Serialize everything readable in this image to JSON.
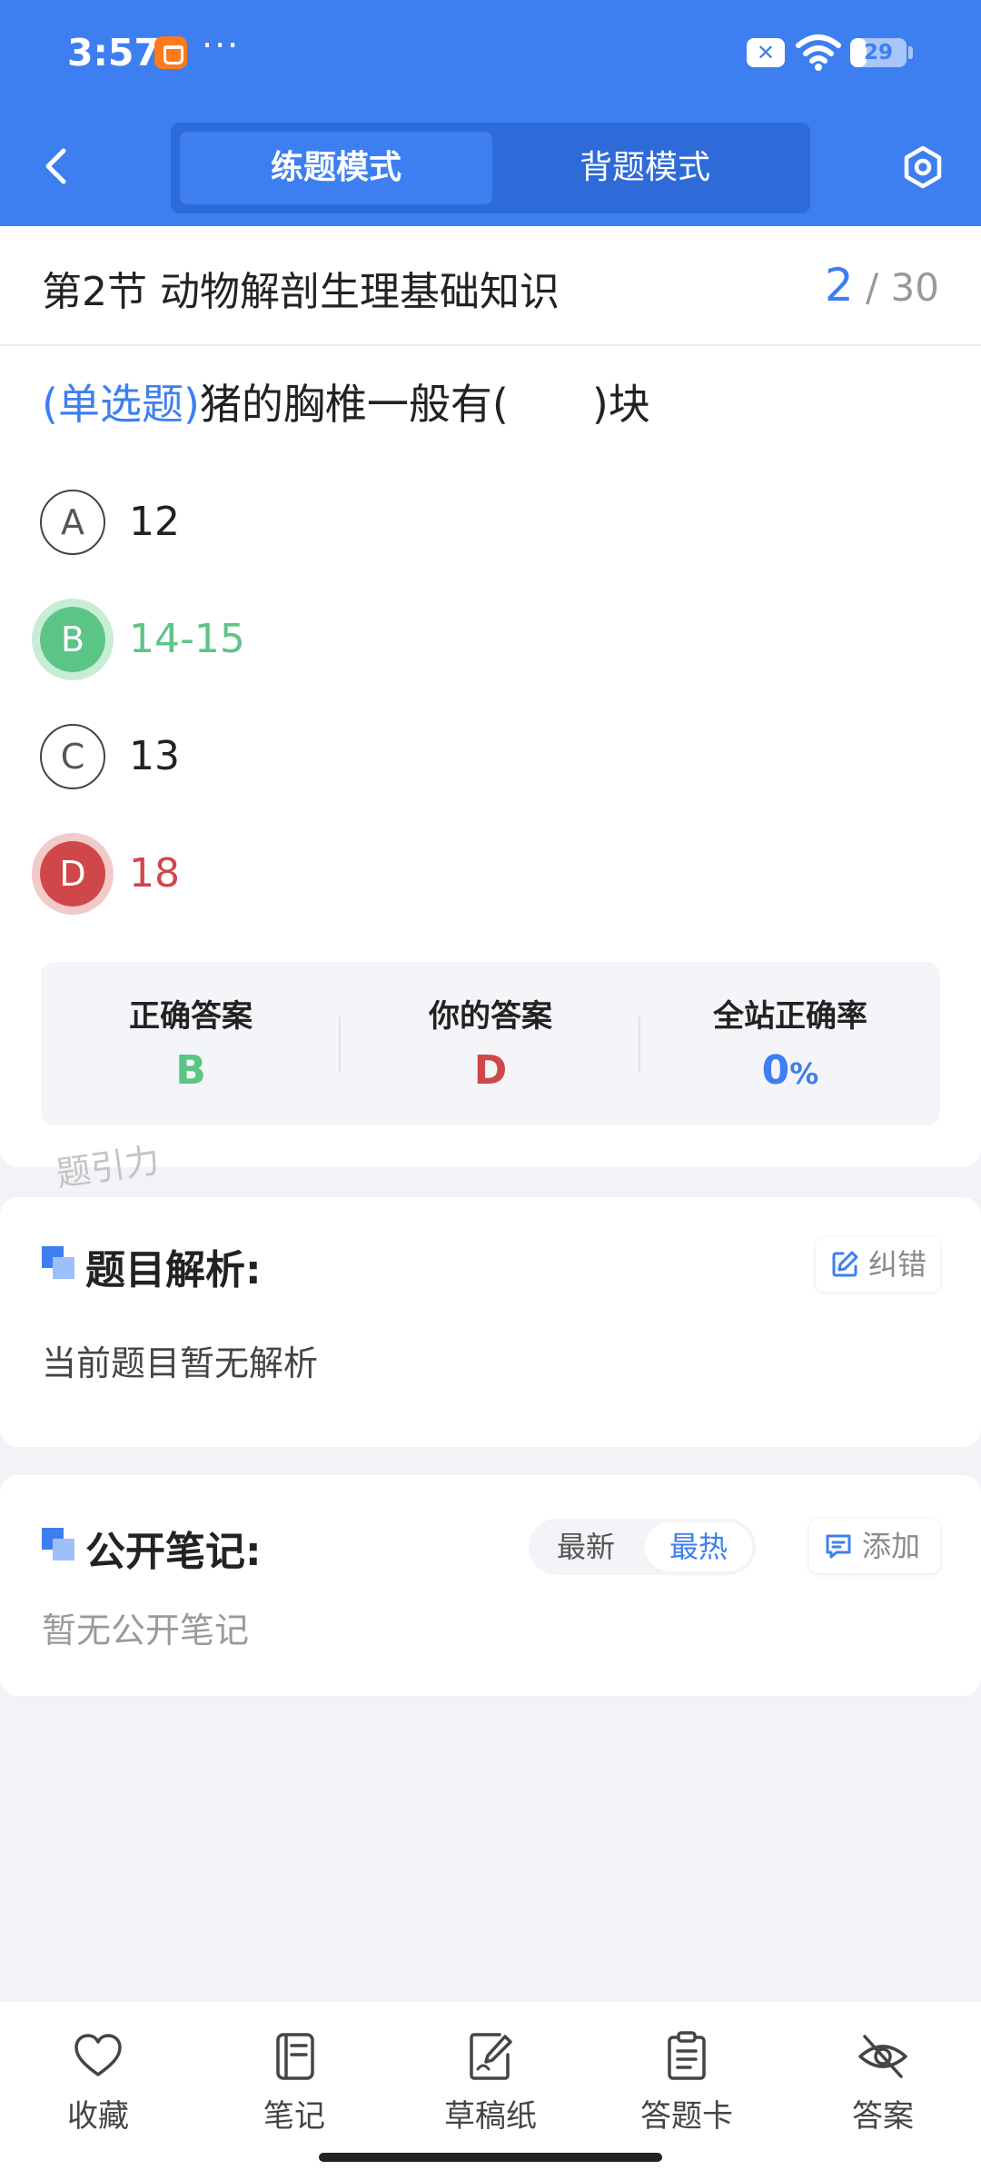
{
  "status_bar": {
    "time": "3:57",
    "more": "···",
    "battery_level": "29",
    "battery_fraction": 0.29
  },
  "header": {
    "mode_tabs": [
      {
        "label": "练题模式",
        "active": true
      },
      {
        "label": "背题模式",
        "active": false
      }
    ],
    "icons": {
      "back": "chevron-left-icon",
      "settings": "hexagon-settings-icon"
    },
    "color": "#3d7ff0"
  },
  "question": {
    "section_title": "第2节 动物解剖生理基础知识",
    "progress_current": "2",
    "progress_total": "/ 30",
    "type_label": "(单选题)",
    "text": "猪的胸椎一般有(　　)块",
    "options": [
      {
        "letter": "A",
        "text": "12",
        "state": "normal"
      },
      {
        "letter": "B",
        "text": "14-15",
        "state": "correct"
      },
      {
        "letter": "C",
        "text": "13",
        "state": "normal"
      },
      {
        "letter": "D",
        "text": "18",
        "state": "wrong"
      }
    ]
  },
  "result": {
    "correct_label": "正确答案",
    "correct_value": "B",
    "yours_label": "你的答案",
    "yours_value": "D",
    "rate_label": "全站正确率",
    "rate_value": "0",
    "rate_unit": "%",
    "colors": {
      "correct": "#5cc585",
      "wrong": "#d0474a",
      "rate": "#3d7ff0"
    }
  },
  "watermark": "题引力",
  "analysis": {
    "title": "题目解析:",
    "correct_button": "纠错",
    "body": "当前题目暂无解析"
  },
  "notes": {
    "title": "公开笔记:",
    "sort_latest": "最新",
    "sort_hot": "最热",
    "add_button": "添加",
    "body": "暂无公开笔记"
  },
  "bottom_nav": [
    {
      "label": "收藏",
      "icon": "heart-icon"
    },
    {
      "label": "笔记",
      "icon": "notebook-icon"
    },
    {
      "label": "草稿纸",
      "icon": "draft-paper-icon"
    },
    {
      "label": "答题卡",
      "icon": "answer-sheet-icon"
    },
    {
      "label": "答案",
      "icon": "eye-hidden-icon"
    }
  ]
}
